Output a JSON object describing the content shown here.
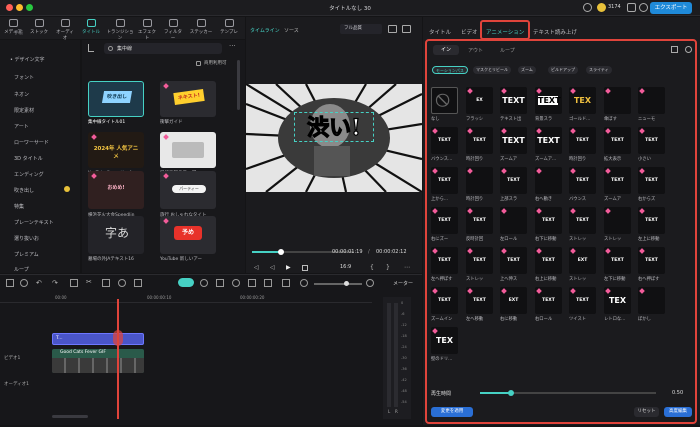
{
  "window": {
    "title": "タイトルなし 30",
    "credits": "3174",
    "export_label": "エクスポート"
  },
  "toolbar": {
    "tabs": [
      "メディア",
      "ストック",
      "オーディオ",
      "タイトル",
      "トランジション",
      "エフェクト",
      "フィルター",
      "ステッカー",
      "テンプレ"
    ],
    "selected": "タイトル"
  },
  "sidebar": {
    "items": [
      "手帳",
      "デザイン文字",
      "フォント",
      "ネオン",
      "限定素材",
      "アート",
      "ローワーサード",
      "3D タイトル",
      "エンディング",
      "吹き出し",
      "特集",
      "プレーンテキスト",
      "選り抜いお",
      "プレミアム",
      "ループ"
    ]
  },
  "browser": {
    "search_value": "集中線",
    "commercial_label": "商用利用可",
    "cards": [
      {
        "label": "集中線タイトル01",
        "thumb": "吹き出し"
      },
      {
        "label": "衝撃ガイド",
        "thumb": "ネキスト!"
      },
      {
        "label": "YouTubeミュージック",
        "thumb": "2024年 人気アニメ"
      },
      {
        "label": "目線強調テロップ",
        "thumb": ""
      },
      {
        "label": "横浜花火大会Speedlin",
        "thumb": "おめめ!"
      },
      {
        "label": "旅行 おしゃれなタイト",
        "thumb": "パーティー"
      },
      {
        "label": "墓場の外JAテキスト16",
        "thumb": "字あ"
      },
      {
        "label": "YouTube 新しいアー",
        "thumb": "予め"
      }
    ]
  },
  "preview": {
    "tabs": [
      "タイムライン",
      "ソース"
    ],
    "quality": "フル品質",
    "caption": "渋い!",
    "current_time": "00:00:01:19",
    "total_time": "00:00:02:12",
    "ratio": "16:9",
    "progress": 0.28
  },
  "right_panel": {
    "tabs": [
      "タイトル",
      "ビデオ",
      "アニメーション",
      "テキスト読み上げ"
    ],
    "selected_tab": "アニメーション",
    "subtabs": [
      "イン",
      "アウト",
      "ループ"
    ],
    "filters": [
      "モーションパス",
      "マスクとリビール",
      "ズーム",
      "ピルドアップ",
      "スライティ"
    ],
    "presets": [
      {
        "label": "なし",
        "glyph": "⃠"
      },
      {
        "label": "フラッシ",
        "glyph": "EX"
      },
      {
        "label": "テキスト出",
        "glyph": "TEXT"
      },
      {
        "label": "背景スラ",
        "glyph": "TEXT"
      },
      {
        "label": "ゴールド...",
        "glyph": "TEX"
      },
      {
        "label": "傘ぼす",
        "glyph": ""
      },
      {
        "label": "ニューモ",
        "glyph": ""
      },
      {
        "label": "バウンス...",
        "glyph": "TEXT"
      },
      {
        "label": "時計回り",
        "glyph": "TEXT"
      },
      {
        "label": "ズームア",
        "glyph": "TEXT"
      },
      {
        "label": "ズームア...",
        "glyph": "TEXT"
      },
      {
        "label": "時計回り",
        "glyph": "TEXT"
      },
      {
        "label": "拡大表示",
        "glyph": "TEXT"
      },
      {
        "label": "小さい",
        "glyph": "TEXT"
      },
      {
        "label": "上から...",
        "glyph": "TEXT"
      },
      {
        "label": "時計回り",
        "glyph": ""
      },
      {
        "label": "上部スラ",
        "glyph": "TEXT"
      },
      {
        "label": "右へ動き",
        "glyph": ""
      },
      {
        "label": "バウンス",
        "glyph": "TEXT"
      },
      {
        "label": "ズームア",
        "glyph": "TEXT"
      },
      {
        "label": "右からズ",
        "glyph": "TEXT"
      },
      {
        "label": "右にズー",
        "glyph": "TEXT"
      },
      {
        "label": "反時計回",
        "glyph": "TEXT"
      },
      {
        "label": "左ロール",
        "glyph": ""
      },
      {
        "label": "右下に移動",
        "glyph": "TEXT"
      },
      {
        "label": "ストレッ",
        "glyph": "TEXT"
      },
      {
        "label": "ストレッ",
        "glyph": ""
      },
      {
        "label": "左上に移動",
        "glyph": "TEXT"
      },
      {
        "label": "左へ押ぼす",
        "glyph": "TEXT"
      },
      {
        "label": "ストレッ",
        "glyph": "TEXT"
      },
      {
        "label": "上へ伸ス",
        "glyph": "TEXT"
      },
      {
        "label": "右上に移動",
        "glyph": "TEXT"
      },
      {
        "label": "ストレッ",
        "glyph": "EXT"
      },
      {
        "label": "左下に移動",
        "glyph": "TEXT"
      },
      {
        "label": "右へ押ぼす",
        "glyph": "TEXT"
      },
      {
        "label": "ズームイン",
        "glyph": "TEXT"
      },
      {
        "label": "左へ移動",
        "glyph": "TEXT"
      },
      {
        "label": "右に移動",
        "glyph": "EXT"
      },
      {
        "label": "右ロール",
        "glyph": "TEXT"
      },
      {
        "label": "ツイスト",
        "glyph": "TEXT"
      },
      {
        "label": "レトロな...",
        "glyph": "TEX"
      },
      {
        "label": "ぼかし",
        "glyph": ""
      },
      {
        "label": "壁のドリ...",
        "glyph": "TEX"
      }
    ],
    "duration_label": "再生時間",
    "duration_value": "0.50",
    "duration_fraction": 0.5,
    "apply_label": "変更を適用",
    "reset_label": "リセット",
    "advanced_label": "高度編集"
  },
  "timeline": {
    "ruler": [
      "00:00",
      "00:00:00:10",
      "00:00:00:20"
    ],
    "meter_label": "メーター",
    "clip_title": "T...",
    "clip_video": "Good Cats Fever GIF",
    "track_video": "ビデオ1",
    "track_audio": "オーディオ1",
    "meter_scale": [
      "0",
      "-6",
      "-12",
      "-18",
      "-24",
      "-30",
      "-36",
      "-42",
      "-48",
      "-54"
    ],
    "lr": [
      "L",
      "R"
    ]
  },
  "colors": {
    "accent": "#46d1c4",
    "highlight": "#e0443b",
    "export": "#1f8ad9",
    "tag": "#f25c9a"
  }
}
